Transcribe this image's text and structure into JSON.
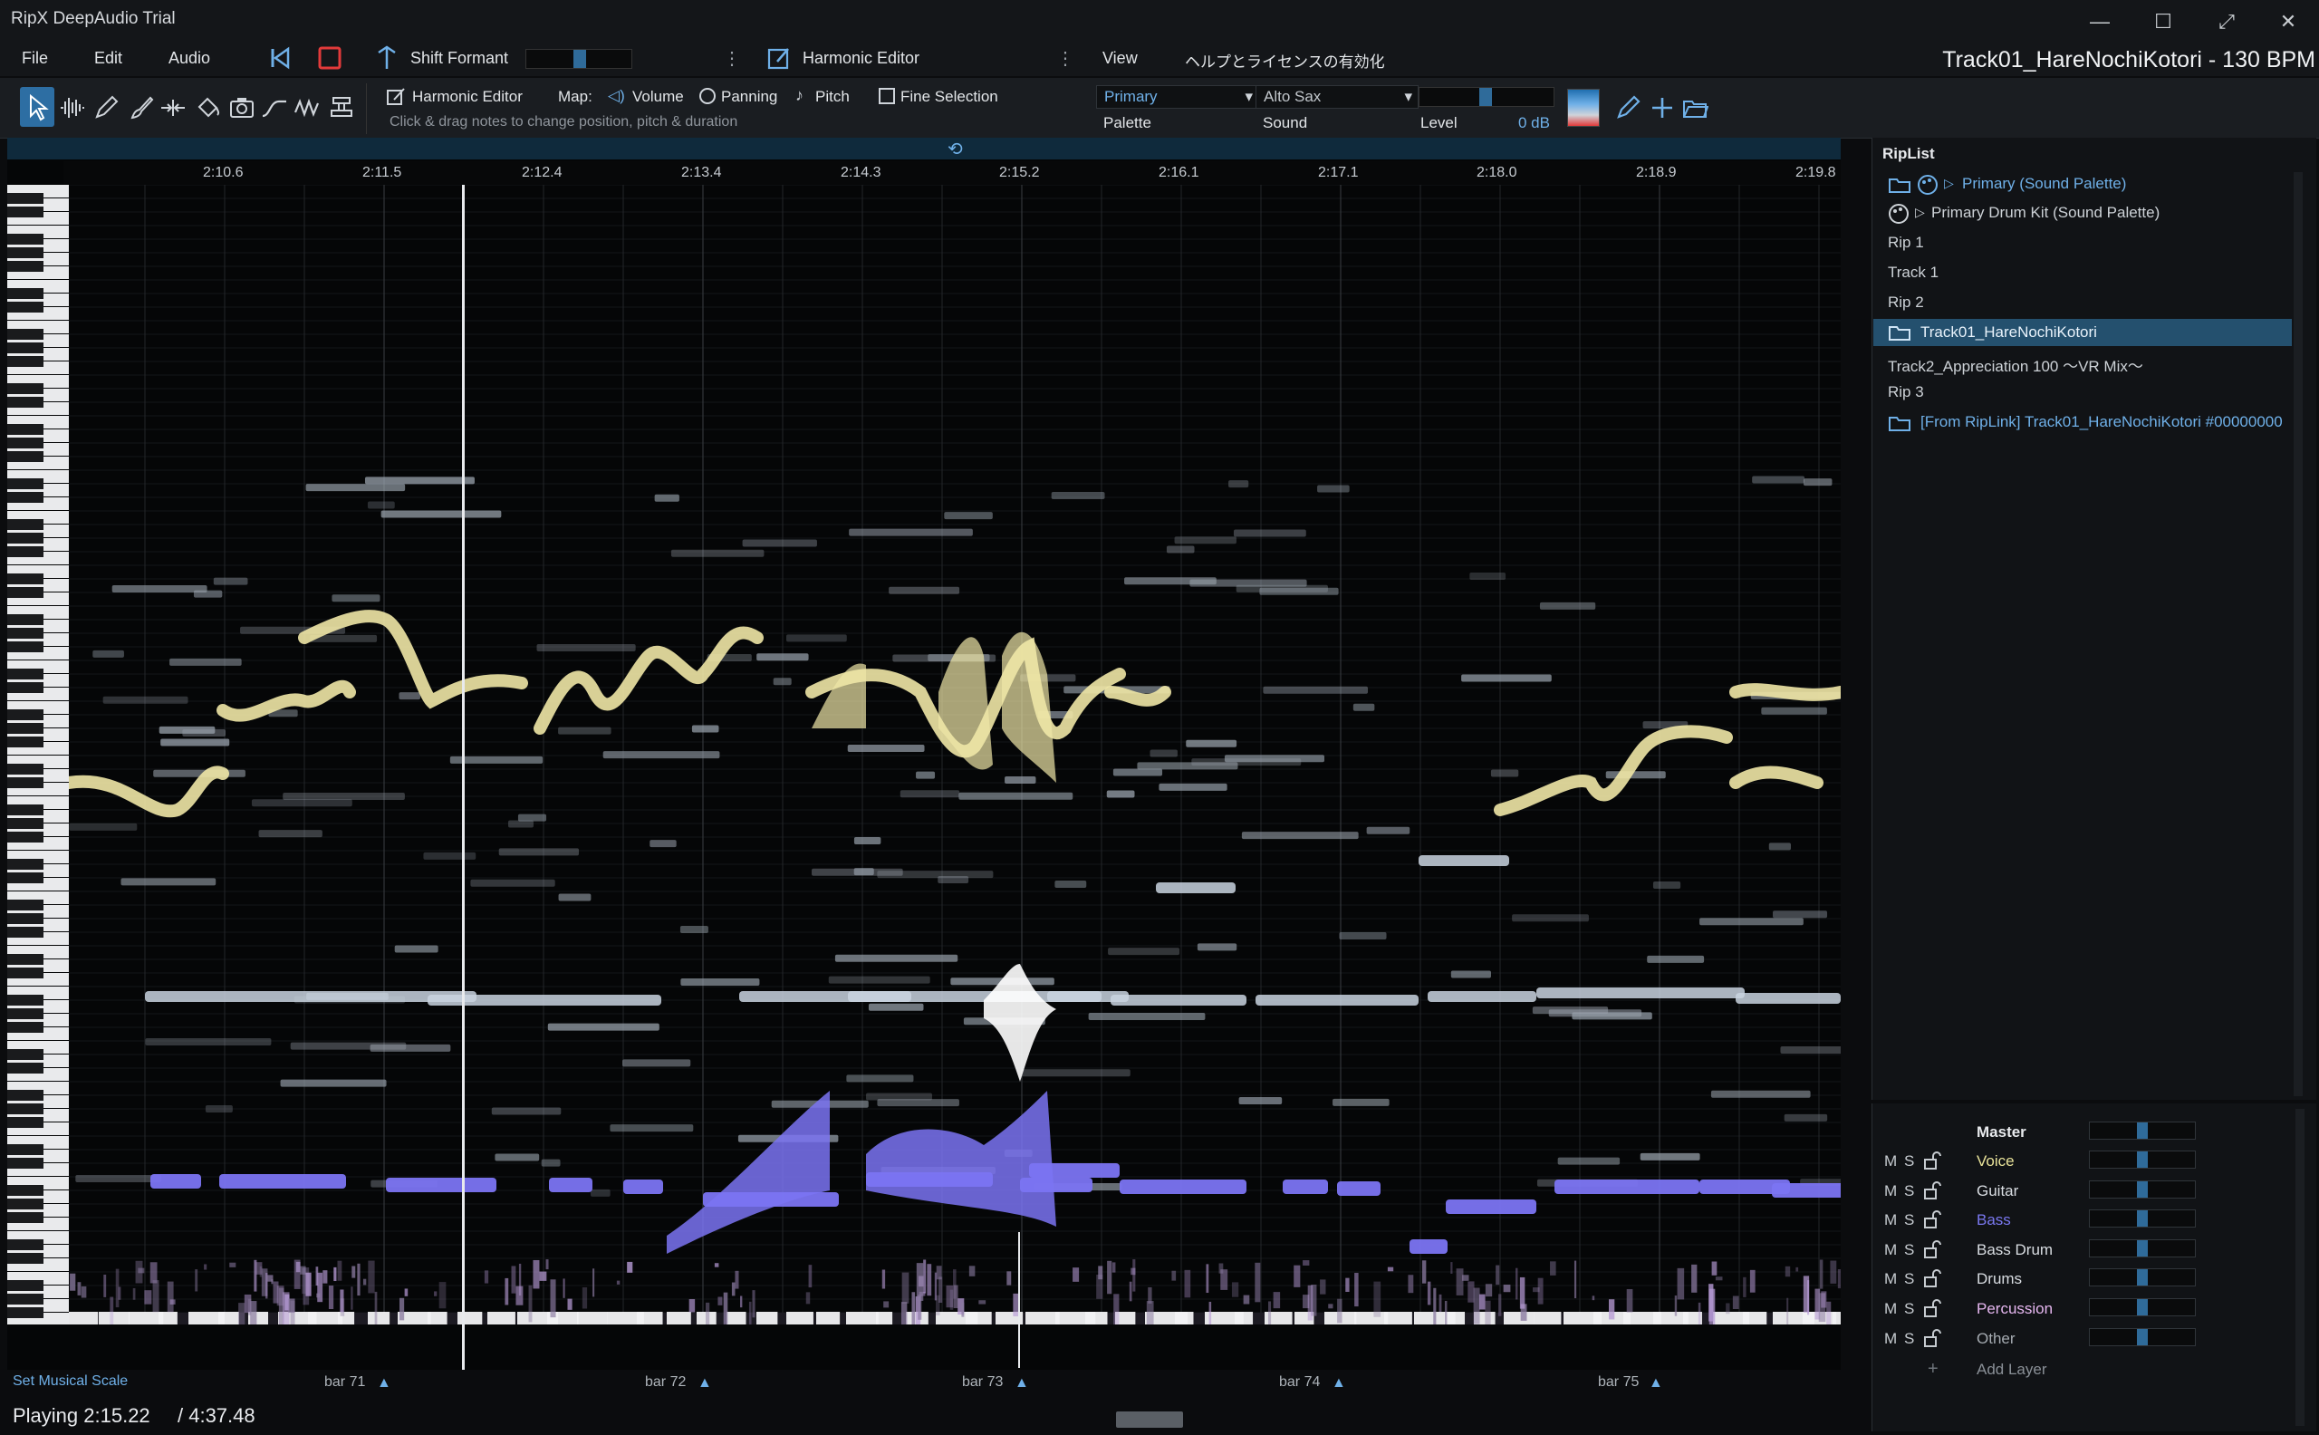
{
  "window": {
    "title": "RipX DeepAudio Trial",
    "minimize": "—",
    "maximize": "☐",
    "restore": "⤢",
    "close": "✕"
  },
  "menu": {
    "file": "File",
    "edit": "Edit",
    "audio": "Audio",
    "shift_formant": "Shift Formant",
    "harmonic_editor": "Harmonic Editor",
    "view": "View",
    "license": "ヘルプとライセンスの有効化",
    "track_title": "Track01_HareNochiKotori - 130 BPM"
  },
  "toolbar": {
    "harmonic_editor": "Harmonic Editor",
    "map_label": "Map:",
    "volume": "Volume",
    "panning": "Panning",
    "pitch": "Pitch",
    "fine_selection": "Fine Selection",
    "hint": "Click & drag notes to change position, pitch & duration",
    "palette_value": "Primary",
    "palette_label": "Palette",
    "sound_value": "Alto Sax",
    "sound_label": "Sound",
    "level_label": "Level",
    "level_value": "0 dB"
  },
  "ruler": {
    "ticks": [
      "2:10.6",
      "2:11.5",
      "2:12.4",
      "2:13.4",
      "2:14.3",
      "2:15.2",
      "2:16.1",
      "2:17.1",
      "2:18.0",
      "2:18.9",
      "2:19.8"
    ]
  },
  "bars": {
    "set_scale": "Set Musical Scale",
    "labels": [
      "bar 71",
      "bar 72",
      "bar 73",
      "bar 74",
      "bar 75"
    ]
  },
  "status": {
    "playing": "Playing 2:15.22",
    "total": "/  4:37.48"
  },
  "riplist": {
    "title": "RipList",
    "items": [
      {
        "label": "Primary (Sound Palette)",
        "icons": "folder palette"
      },
      {
        "label": "Primary Drum Kit (Sound Palette)",
        "icons": "palette"
      },
      {
        "label": "Rip 1"
      },
      {
        "label": "Track 1"
      },
      {
        "label": "Rip 2"
      },
      {
        "label": "Track01_HareNochiKotori",
        "selected": true
      },
      {
        "label": "Track2_Appreciation 100 〜VR Mix〜"
      },
      {
        "label": "Rip 3"
      },
      {
        "label": "[From RipLink] Track01_HareNochiKotori #00000000"
      }
    ]
  },
  "mixer": {
    "master": "Master",
    "m": "M",
    "s": "S",
    "layers": [
      {
        "name": "Voice",
        "color": "#e9e39a"
      },
      {
        "name": "Guitar",
        "color": "#d9dde2"
      },
      {
        "name": "Bass",
        "color": "#7a78f0"
      },
      {
        "name": "Bass Drum",
        "color": "#d9dde2"
      },
      {
        "name": "Drums",
        "color": "#d9dde2"
      },
      {
        "name": "Percussion",
        "color": "#e6b7f0"
      },
      {
        "name": "Other",
        "color": "#a5abb1"
      }
    ],
    "add_layer": "Add Layer"
  },
  "colors": {
    "voice": "#efe7a6",
    "guitar": "#c9d4df",
    "bass": "#7b74f2",
    "accent": "#6fb0e8",
    "selected": "#24506e"
  }
}
